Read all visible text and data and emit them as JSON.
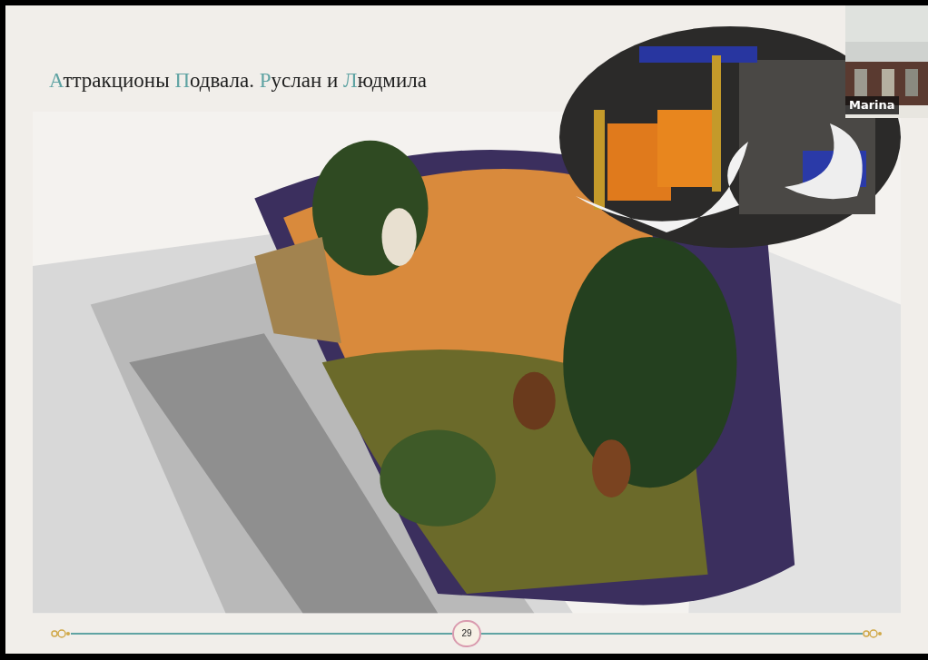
{
  "slide": {
    "title_parts": [
      {
        "text": "А",
        "accent": true
      },
      {
        "text": "ттракционы ",
        "accent": false
      },
      {
        "text": "П",
        "accent": true
      },
      {
        "text": "одвала. ",
        "accent": false
      },
      {
        "text": "Р",
        "accent": true
      },
      {
        "text": "услан и ",
        "accent": false
      },
      {
        "text": "Л",
        "accent": true
      },
      {
        "text": "юдмила",
        "accent": false
      }
    ],
    "page_number": "29"
  },
  "participant": {
    "name": "Marina"
  }
}
